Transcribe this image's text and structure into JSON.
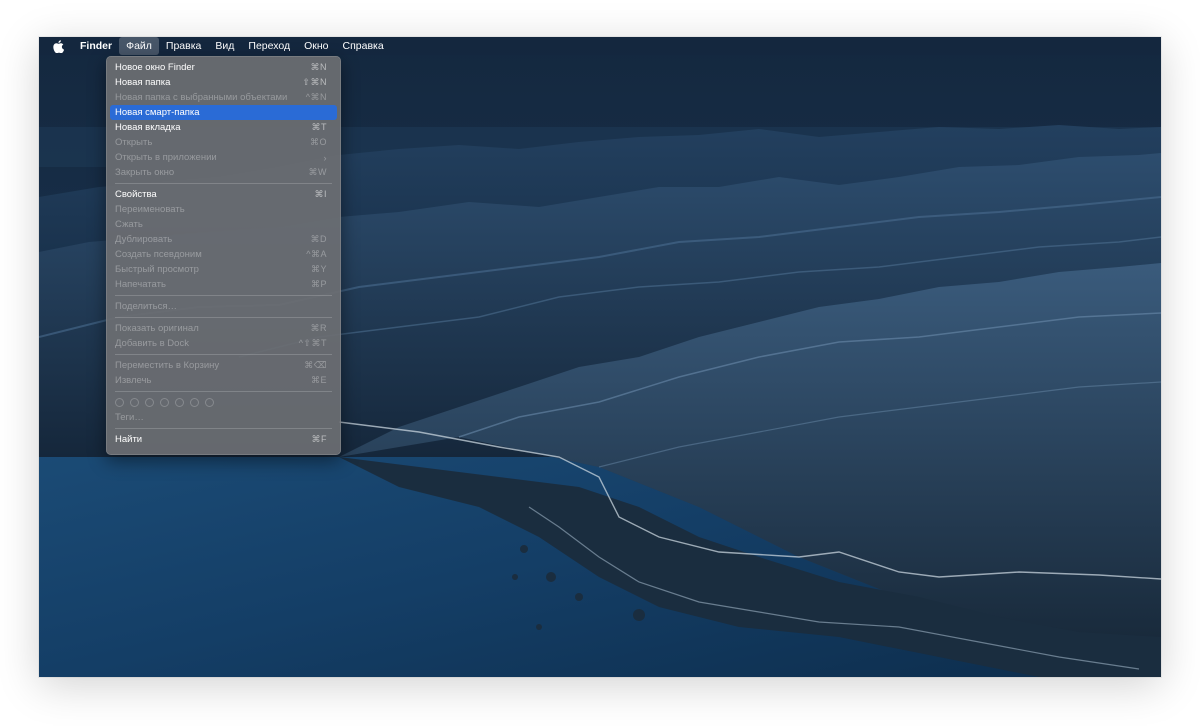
{
  "menubar": {
    "app_name": "Finder",
    "items": [
      "Файл",
      "Правка",
      "Вид",
      "Переход",
      "Окно",
      "Справка"
    ]
  },
  "menu": {
    "items": [
      {
        "label": "Новое окно Finder",
        "shortcut": "⌘N",
        "disabled": false
      },
      {
        "label": "Новая папка",
        "shortcut": "⇧⌘N",
        "disabled": false
      },
      {
        "label": "Новая папка с выбранными объектами",
        "shortcut": "^⌘N",
        "disabled": true
      },
      {
        "label": "Новая смарт-папка",
        "shortcut": "",
        "disabled": false,
        "highlighted": true
      },
      {
        "label": "Новая вкладка",
        "shortcut": "⌘T",
        "disabled": false
      },
      {
        "label": "Открыть",
        "shortcut": "⌘O",
        "disabled": true
      },
      {
        "label": "Открыть в приложении",
        "shortcut": "›",
        "disabled": true
      },
      {
        "label": "Закрыть окно",
        "shortcut": "⌘W",
        "disabled": true
      },
      {
        "label": "Свойства",
        "shortcut": "⌘I",
        "disabled": false
      },
      {
        "label": "Переименовать",
        "shortcut": "",
        "disabled": true
      },
      {
        "label": "Сжать",
        "shortcut": "",
        "disabled": true
      },
      {
        "label": "Дублировать",
        "shortcut": "⌘D",
        "disabled": true
      },
      {
        "label": "Создать псевдоним",
        "shortcut": "^⌘A",
        "disabled": true
      },
      {
        "label": "Быстрый просмотр",
        "shortcut": "⌘Y",
        "disabled": true
      },
      {
        "label": "Напечатать",
        "shortcut": "⌘P",
        "disabled": true
      },
      {
        "label": "Поделиться…",
        "shortcut": "",
        "disabled": true
      },
      {
        "label": "Показать оригинал",
        "shortcut": "⌘R",
        "disabled": true
      },
      {
        "label": "Добавить в Dock",
        "shortcut": "^⇧⌘T",
        "disabled": true
      },
      {
        "label": "Переместить в Корзину",
        "shortcut": "⌘⌫",
        "disabled": true
      },
      {
        "label": "Извлечь",
        "shortcut": "⌘E",
        "disabled": true
      },
      {
        "label": "Теги…",
        "shortcut": "",
        "disabled": true
      },
      {
        "label": "Найти",
        "shortcut": "⌘F",
        "disabled": false
      }
    ]
  },
  "colors": {
    "highlight": "#2a6bd6",
    "menu_bg": "#6c6e72"
  }
}
